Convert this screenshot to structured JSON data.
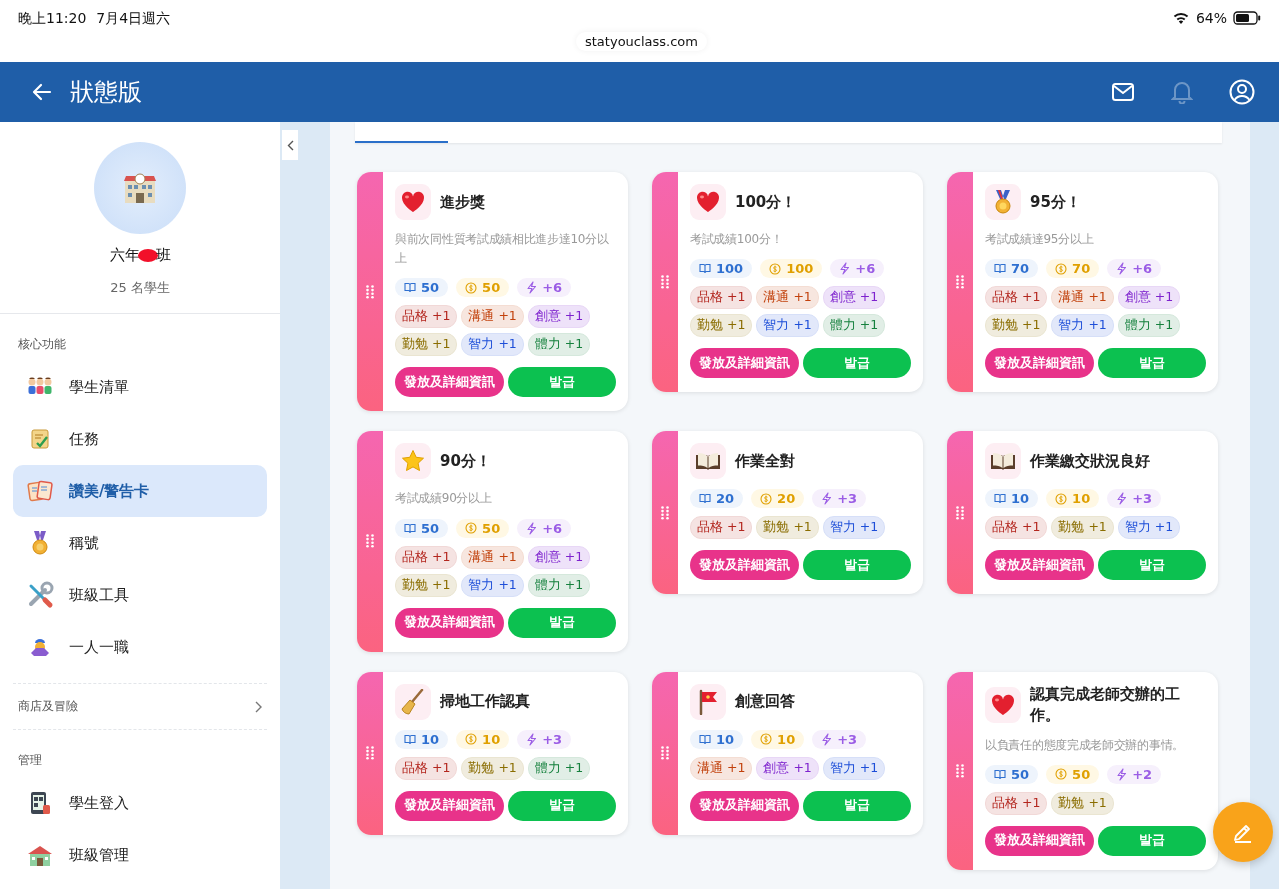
{
  "status_bar": {
    "time": "晚上11:20",
    "date": "7月4日週六",
    "battery": "64%"
  },
  "url": "statyouclass.com",
  "header": {
    "title": "狀態版"
  },
  "sidebar": {
    "class_name_parts": [
      "六年",
      "班"
    ],
    "student_count": "25 名學生",
    "sections": [
      {
        "label": "核心功能",
        "collapsible": false,
        "items": [
          {
            "label": "學生清單",
            "selected": false
          },
          {
            "label": "任務",
            "selected": false
          },
          {
            "label": "讚美/警告卡",
            "selected": true
          },
          {
            "label": "稱號",
            "selected": false
          },
          {
            "label": "班級工具",
            "selected": false
          },
          {
            "label": "一人一職",
            "selected": false
          }
        ]
      },
      {
        "label": "商店及冒險",
        "collapsible": true
      },
      {
        "label": "管理",
        "collapsible": false,
        "items": [
          {
            "label": "學生登入",
            "selected": false
          },
          {
            "label": "班級管理",
            "selected": false
          }
        ]
      }
    ]
  },
  "cards": [
    {
      "title": "進步獎",
      "description": "與前次同性質考試成績相比進步達10分以上",
      "rewards": [
        {
          "kind": "book",
          "value": "50"
        },
        {
          "kind": "coin",
          "value": "50"
        },
        {
          "kind": "bolt",
          "value": "+6"
        }
      ],
      "attributes": [
        {
          "label": "品格 +1",
          "color": "#b3261e"
        },
        {
          "label": "溝通 +1",
          "color": "#c2410c"
        },
        {
          "label": "創意 +1",
          "color": "#7e22ce"
        },
        {
          "label": "勤勉 +1",
          "color": "#8a6d00"
        },
        {
          "label": "智力 +1",
          "color": "#1d4ed8"
        },
        {
          "label": "體力 +1",
          "color": "#15803d"
        }
      ],
      "buttons": [
        "發放及詳細資訊",
        "발급"
      ]
    },
    {
      "title": "100分！",
      "description": "考試成績100分！",
      "rewards": [
        {
          "kind": "book",
          "value": "100"
        },
        {
          "kind": "coin",
          "value": "100"
        },
        {
          "kind": "bolt",
          "value": "+6"
        }
      ],
      "attributes": [
        {
          "label": "品格 +1",
          "color": "#b3261e"
        },
        {
          "label": "溝通 +1",
          "color": "#c2410c"
        },
        {
          "label": "創意 +1",
          "color": "#7e22ce"
        },
        {
          "label": "勤勉 +1",
          "color": "#8a6d00"
        },
        {
          "label": "智力 +1",
          "color": "#1d4ed8"
        },
        {
          "label": "體力 +1",
          "color": "#15803d"
        }
      ],
      "buttons": [
        "發放及詳細資訊",
        "발급"
      ]
    },
    {
      "title": "95分！",
      "description": "考試成績達95分以上",
      "rewards": [
        {
          "kind": "book",
          "value": "70"
        },
        {
          "kind": "coin",
          "value": "70"
        },
        {
          "kind": "bolt",
          "value": "+6"
        }
      ],
      "attributes": [
        {
          "label": "品格 +1",
          "color": "#b3261e"
        },
        {
          "label": "溝通 +1",
          "color": "#c2410c"
        },
        {
          "label": "創意 +1",
          "color": "#7e22ce"
        },
        {
          "label": "勤勉 +1",
          "color": "#8a6d00"
        },
        {
          "label": "智力 +1",
          "color": "#1d4ed8"
        },
        {
          "label": "體力 +1",
          "color": "#15803d"
        }
      ],
      "buttons": [
        "發放及詳細資訊",
        "발급"
      ]
    },
    {
      "title": "90分！",
      "description": "考試成績90分以上",
      "rewards": [
        {
          "kind": "book",
          "value": "50"
        },
        {
          "kind": "coin",
          "value": "50"
        },
        {
          "kind": "bolt",
          "value": "+6"
        }
      ],
      "attributes": [
        {
          "label": "品格 +1",
          "color": "#b3261e"
        },
        {
          "label": "溝通 +1",
          "color": "#c2410c"
        },
        {
          "label": "創意 +1",
          "color": "#7e22ce"
        },
        {
          "label": "勤勉 +1",
          "color": "#8a6d00"
        },
        {
          "label": "智力 +1",
          "color": "#1d4ed8"
        },
        {
          "label": "體力 +1",
          "color": "#15803d"
        }
      ],
      "buttons": [
        "發放及詳細資訊",
        "발급"
      ]
    },
    {
      "title": "作業全對",
      "rewards": [
        {
          "kind": "book",
          "value": "20"
        },
        {
          "kind": "coin",
          "value": "20"
        },
        {
          "kind": "bolt",
          "value": "+3"
        }
      ],
      "attributes": [
        {
          "label": "品格 +1",
          "color": "#b3261e"
        },
        {
          "label": "勤勉 +1",
          "color": "#8a6d00"
        },
        {
          "label": "智力 +1",
          "color": "#1d4ed8"
        }
      ],
      "buttons": [
        "發放及詳細資訊",
        "발급"
      ]
    },
    {
      "title": "作業繳交狀況良好",
      "rewards": [
        {
          "kind": "book",
          "value": "10"
        },
        {
          "kind": "coin",
          "value": "10"
        },
        {
          "kind": "bolt",
          "value": "+3"
        }
      ],
      "attributes": [
        {
          "label": "品格 +1",
          "color": "#b3261e"
        },
        {
          "label": "勤勉 +1",
          "color": "#8a6d00"
        },
        {
          "label": "智力 +1",
          "color": "#1d4ed8"
        }
      ],
      "buttons": [
        "發放及詳細資訊",
        "발급"
      ]
    },
    {
      "title": "掃地工作認真",
      "rewards": [
        {
          "kind": "book",
          "value": "10"
        },
        {
          "kind": "coin",
          "value": "10"
        },
        {
          "kind": "bolt",
          "value": "+3"
        }
      ],
      "attributes": [
        {
          "label": "品格 +1",
          "color": "#b3261e"
        },
        {
          "label": "勤勉 +1",
          "color": "#8a6d00"
        },
        {
          "label": "體力 +1",
          "color": "#15803d"
        }
      ],
      "buttons": [
        "發放及詳細資訊",
        "발급"
      ]
    },
    {
      "title": "創意回答",
      "rewards": [
        {
          "kind": "book",
          "value": "10"
        },
        {
          "kind": "coin",
          "value": "10"
        },
        {
          "kind": "bolt",
          "value": "+3"
        }
      ],
      "attributes": [
        {
          "label": "溝通 +1",
          "color": "#c2410c"
        },
        {
          "label": "創意 +1",
          "color": "#7e22ce"
        },
        {
          "label": "智力 +1",
          "color": "#1d4ed8"
        }
      ],
      "buttons": [
        "發放及詳細資訊",
        "발급"
      ]
    },
    {
      "title": "認真完成老師交辦的工作。",
      "description": "以負責任的態度完成老師交辦的事情。",
      "rewards": [
        {
          "kind": "book",
          "value": "50"
        },
        {
          "kind": "coin",
          "value": "50"
        },
        {
          "kind": "bolt",
          "value": "+2"
        }
      ],
      "attributes": [
        {
          "label": "品格 +1",
          "color": "#b3261e"
        },
        {
          "label": "勤勉 +1",
          "color": "#8a6d00"
        }
      ],
      "buttons": [
        "發放及詳細資訊",
        "발급"
      ]
    }
  ]
}
